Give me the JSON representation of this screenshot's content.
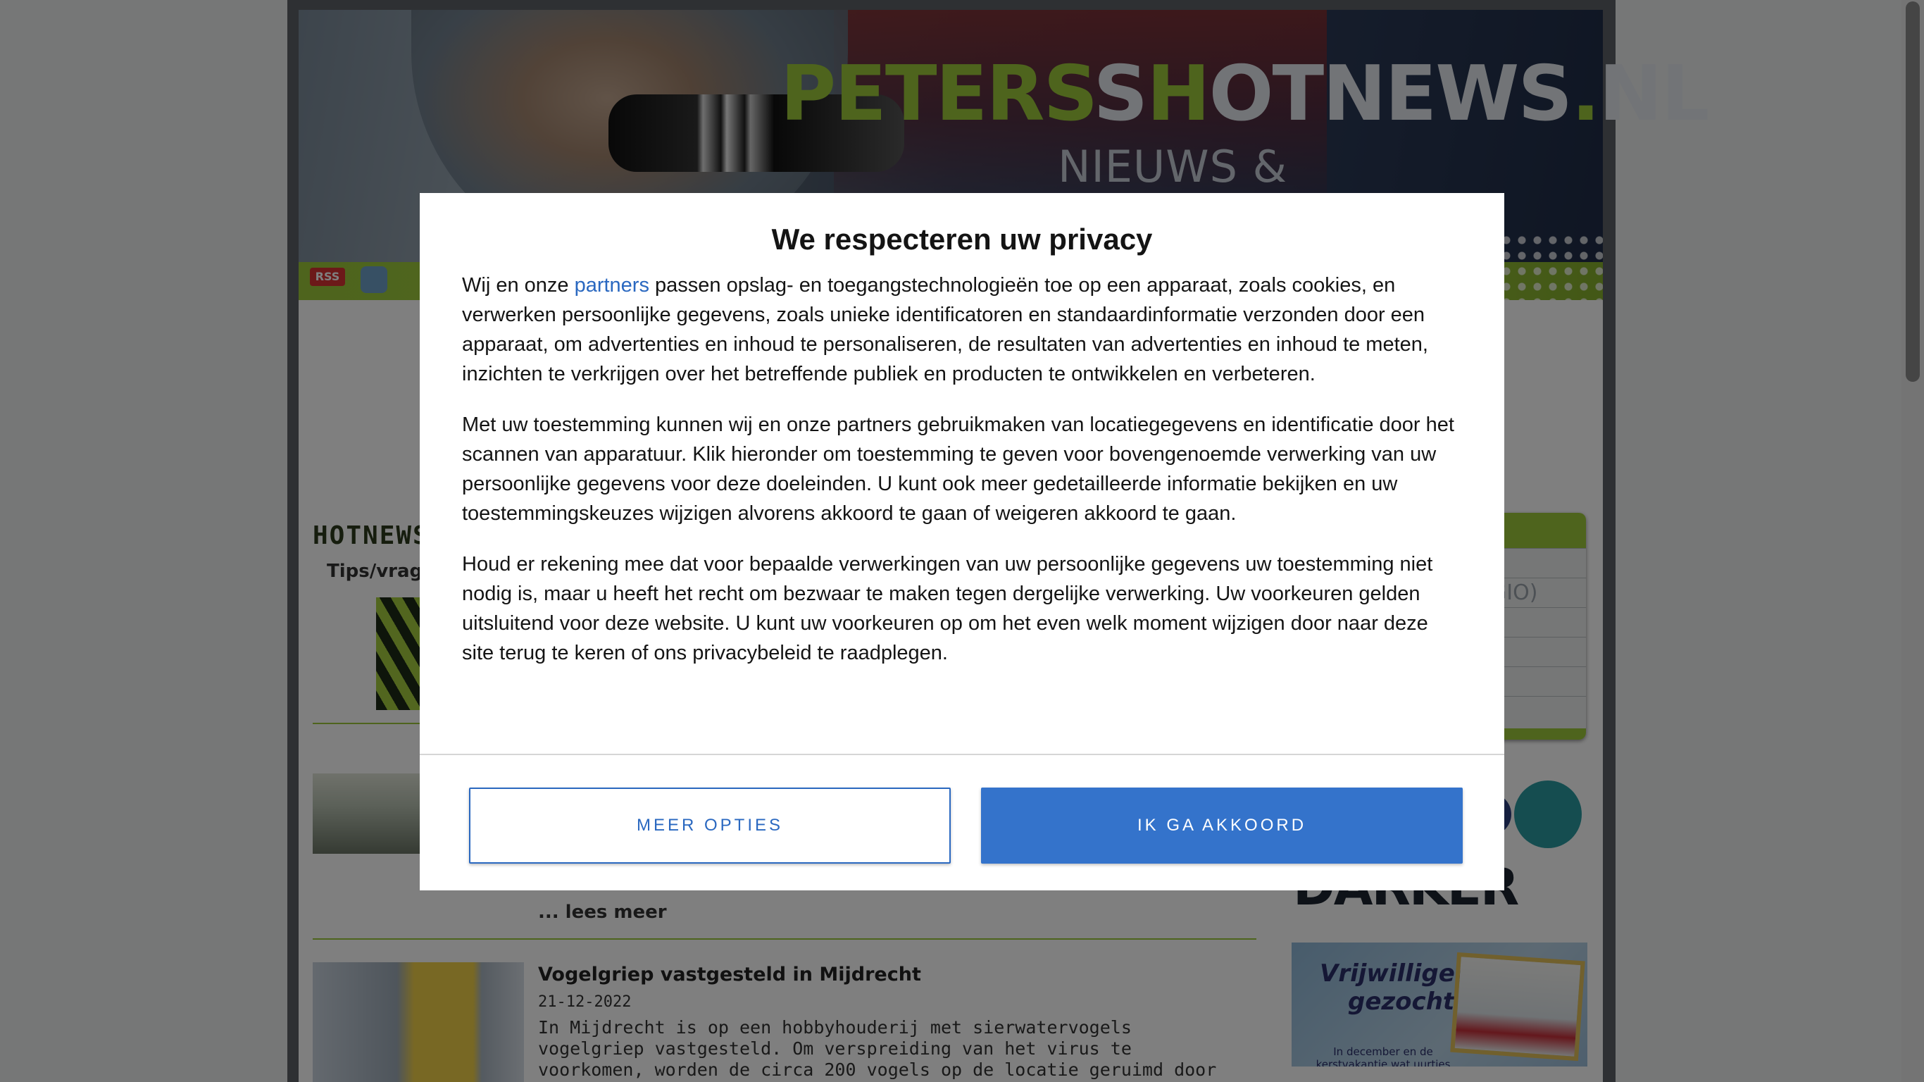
{
  "header": {
    "logo_prefix": "PETERS",
    "logo_h": "H",
    "logo_mid": "OTNEWS",
    "logo_dot": ".",
    "logo_suffix": "NL",
    "subtitle": "NIEUWS & FOTOGRAFIE",
    "rss_label": "RSS"
  },
  "left_column": {
    "heading": "HOTNEWS",
    "tips": "Tips/vrag"
  },
  "articles": [
    {
      "read_more": "... lees meer"
    },
    {
      "title": "Vogelgriep vastgesteld in Mijdrecht",
      "date": "21-12-2022",
      "text": "In Mijdrecht is op een hobbyhouderij met sierwatervogels vogelgriep vastgesteld. Om verspreiding van het virus te voorkomen, worden de circa 200 vogels op de locatie geruimd door de Nederlandse Voedsel"
    }
  ],
  "sidebar": {
    "menu_partial_text": "GIO)",
    "ad_logo_text": "DARKER MEDIA",
    "ad_vrijwilligers_line1": "Vrijwilligers",
    "ad_vrijwilligers_line2": "gezocht",
    "ad_vrijwilligers_small": "In december en de kerstvakantie wat uurtjes over?"
  },
  "consent": {
    "title": "We respecteren uw privacy",
    "p1_before_link": "Wij en onze ",
    "p1_link": "partners",
    "p1_after_link": " passen opslag- en toegangstechnologieën toe op een apparaat, zoals cookies, en verwerken persoonlijke gegevens, zoals unieke identificatoren en standaardinformatie verzonden door een apparaat, om advertenties en inhoud te personaliseren, de resultaten van advertenties en inhoud te meten, inzichten te verkrijgen over het betreffende publiek en producten te ontwikkelen en verbeteren.",
    "p2": "Met uw toestemming kunnen wij en onze partners gebruikmaken van locatiegegevens en identificatie door het scannen van apparatuur. Klik hieronder om toestemming te geven voor bovengenoemde verwerking van uw persoonlijke gegevens voor deze doeleinden. U kunt ook meer gedetailleerde informatie bekijken en uw toestemmingskeuzes wijzigen alvorens akkoord te gaan of weigeren akkoord te gaan.",
    "p3": "Houd er rekening mee dat voor bepaalde verwerkingen van uw persoonlijke gegevens uw toestemming niet nodig is, maar u heeft het recht om bezwaar te maken tegen dergelijke verwerking. Uw voorkeuren gelden uitsluitend voor deze website. U kunt uw voorkeuren op om het even welk moment wijzigen door naar deze site terug te keren of ons privacybeleid te raadplegen.",
    "btn_more": "MEER OPTIES",
    "btn_agree": "IK GA AKKOORD"
  },
  "colors": {
    "accent_green": "#9cc93a",
    "button_blue": "#3473cb",
    "link_blue": "#2a68c0"
  }
}
